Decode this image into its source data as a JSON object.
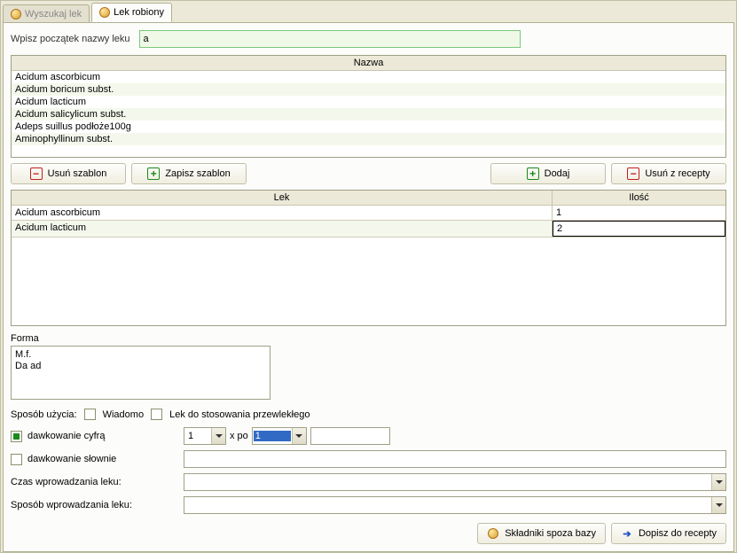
{
  "tabs": {
    "inactive": "Wyszukaj lek",
    "active": "Lek robiony"
  },
  "search": {
    "label": "Wpisz początek nazwy leku",
    "value": "a"
  },
  "name_table": {
    "header": "Nazwa",
    "rows": [
      "Acidum ascorbicum",
      "Acidum boricum subst.",
      "Acidum lacticum",
      "Acidum salicylicum subst.",
      "Adeps suillus podłoże100g",
      "Aminophyllinum subst."
    ]
  },
  "buttons": {
    "usun_szablon": "Usuń szablon",
    "zapisz_szablon": "Zapisz szablon",
    "dodaj": "Dodaj",
    "usun_z_recepty": "Usuń z recepty"
  },
  "lek_table": {
    "col_lek": "Lek",
    "col_ilosc": "Ilość",
    "rows": [
      {
        "lek": "Acidum ascorbicum",
        "ilosc": "1"
      },
      {
        "lek": "Acidum lacticum",
        "ilosc": "2"
      }
    ]
  },
  "forma": {
    "label": "Forma",
    "text": "M.f.\nDa ad"
  },
  "usage": {
    "label": "Sposób użycia:",
    "wiadomo": "Wiadomo",
    "przewlekle": "Lek do stosowania przewlekłego"
  },
  "dose": {
    "cyfra": "dawkowanie cyfrą",
    "slownie": "dawkowanie słownie",
    "val1": "1",
    "xpo": "x po",
    "val2": "1",
    "czas_label": "Czas wprowadzania leku:",
    "sposob_label": "Sposób wprowadzania leku:"
  },
  "footer": {
    "skladniki": "Składniki spoza bazy",
    "dopisz": "Dopisz do recepty"
  }
}
